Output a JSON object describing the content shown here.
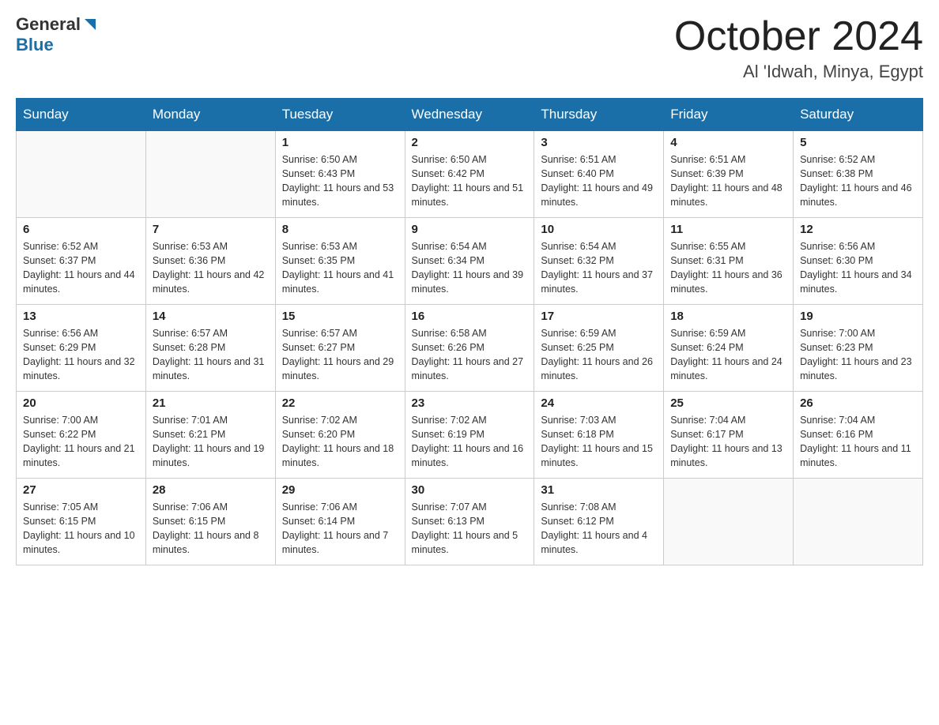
{
  "header": {
    "logo_general": "General",
    "logo_blue": "Blue",
    "month_title": "October 2024",
    "location": "Al 'Idwah, Minya, Egypt"
  },
  "days_of_week": [
    "Sunday",
    "Monday",
    "Tuesday",
    "Wednesday",
    "Thursday",
    "Friday",
    "Saturday"
  ],
  "weeks": [
    [
      {
        "day": "",
        "sunrise": "",
        "sunset": "",
        "daylight": ""
      },
      {
        "day": "",
        "sunrise": "",
        "sunset": "",
        "daylight": ""
      },
      {
        "day": "1",
        "sunrise": "Sunrise: 6:50 AM",
        "sunset": "Sunset: 6:43 PM",
        "daylight": "Daylight: 11 hours and 53 minutes."
      },
      {
        "day": "2",
        "sunrise": "Sunrise: 6:50 AM",
        "sunset": "Sunset: 6:42 PM",
        "daylight": "Daylight: 11 hours and 51 minutes."
      },
      {
        "day": "3",
        "sunrise": "Sunrise: 6:51 AM",
        "sunset": "Sunset: 6:40 PM",
        "daylight": "Daylight: 11 hours and 49 minutes."
      },
      {
        "day": "4",
        "sunrise": "Sunrise: 6:51 AM",
        "sunset": "Sunset: 6:39 PM",
        "daylight": "Daylight: 11 hours and 48 minutes."
      },
      {
        "day": "5",
        "sunrise": "Sunrise: 6:52 AM",
        "sunset": "Sunset: 6:38 PM",
        "daylight": "Daylight: 11 hours and 46 minutes."
      }
    ],
    [
      {
        "day": "6",
        "sunrise": "Sunrise: 6:52 AM",
        "sunset": "Sunset: 6:37 PM",
        "daylight": "Daylight: 11 hours and 44 minutes."
      },
      {
        "day": "7",
        "sunrise": "Sunrise: 6:53 AM",
        "sunset": "Sunset: 6:36 PM",
        "daylight": "Daylight: 11 hours and 42 minutes."
      },
      {
        "day": "8",
        "sunrise": "Sunrise: 6:53 AM",
        "sunset": "Sunset: 6:35 PM",
        "daylight": "Daylight: 11 hours and 41 minutes."
      },
      {
        "day": "9",
        "sunrise": "Sunrise: 6:54 AM",
        "sunset": "Sunset: 6:34 PM",
        "daylight": "Daylight: 11 hours and 39 minutes."
      },
      {
        "day": "10",
        "sunrise": "Sunrise: 6:54 AM",
        "sunset": "Sunset: 6:32 PM",
        "daylight": "Daylight: 11 hours and 37 minutes."
      },
      {
        "day": "11",
        "sunrise": "Sunrise: 6:55 AM",
        "sunset": "Sunset: 6:31 PM",
        "daylight": "Daylight: 11 hours and 36 minutes."
      },
      {
        "day": "12",
        "sunrise": "Sunrise: 6:56 AM",
        "sunset": "Sunset: 6:30 PM",
        "daylight": "Daylight: 11 hours and 34 minutes."
      }
    ],
    [
      {
        "day": "13",
        "sunrise": "Sunrise: 6:56 AM",
        "sunset": "Sunset: 6:29 PM",
        "daylight": "Daylight: 11 hours and 32 minutes."
      },
      {
        "day": "14",
        "sunrise": "Sunrise: 6:57 AM",
        "sunset": "Sunset: 6:28 PM",
        "daylight": "Daylight: 11 hours and 31 minutes."
      },
      {
        "day": "15",
        "sunrise": "Sunrise: 6:57 AM",
        "sunset": "Sunset: 6:27 PM",
        "daylight": "Daylight: 11 hours and 29 minutes."
      },
      {
        "day": "16",
        "sunrise": "Sunrise: 6:58 AM",
        "sunset": "Sunset: 6:26 PM",
        "daylight": "Daylight: 11 hours and 27 minutes."
      },
      {
        "day": "17",
        "sunrise": "Sunrise: 6:59 AM",
        "sunset": "Sunset: 6:25 PM",
        "daylight": "Daylight: 11 hours and 26 minutes."
      },
      {
        "day": "18",
        "sunrise": "Sunrise: 6:59 AM",
        "sunset": "Sunset: 6:24 PM",
        "daylight": "Daylight: 11 hours and 24 minutes."
      },
      {
        "day": "19",
        "sunrise": "Sunrise: 7:00 AM",
        "sunset": "Sunset: 6:23 PM",
        "daylight": "Daylight: 11 hours and 23 minutes."
      }
    ],
    [
      {
        "day": "20",
        "sunrise": "Sunrise: 7:00 AM",
        "sunset": "Sunset: 6:22 PM",
        "daylight": "Daylight: 11 hours and 21 minutes."
      },
      {
        "day": "21",
        "sunrise": "Sunrise: 7:01 AM",
        "sunset": "Sunset: 6:21 PM",
        "daylight": "Daylight: 11 hours and 19 minutes."
      },
      {
        "day": "22",
        "sunrise": "Sunrise: 7:02 AM",
        "sunset": "Sunset: 6:20 PM",
        "daylight": "Daylight: 11 hours and 18 minutes."
      },
      {
        "day": "23",
        "sunrise": "Sunrise: 7:02 AM",
        "sunset": "Sunset: 6:19 PM",
        "daylight": "Daylight: 11 hours and 16 minutes."
      },
      {
        "day": "24",
        "sunrise": "Sunrise: 7:03 AM",
        "sunset": "Sunset: 6:18 PM",
        "daylight": "Daylight: 11 hours and 15 minutes."
      },
      {
        "day": "25",
        "sunrise": "Sunrise: 7:04 AM",
        "sunset": "Sunset: 6:17 PM",
        "daylight": "Daylight: 11 hours and 13 minutes."
      },
      {
        "day": "26",
        "sunrise": "Sunrise: 7:04 AM",
        "sunset": "Sunset: 6:16 PM",
        "daylight": "Daylight: 11 hours and 11 minutes."
      }
    ],
    [
      {
        "day": "27",
        "sunrise": "Sunrise: 7:05 AM",
        "sunset": "Sunset: 6:15 PM",
        "daylight": "Daylight: 11 hours and 10 minutes."
      },
      {
        "day": "28",
        "sunrise": "Sunrise: 7:06 AM",
        "sunset": "Sunset: 6:15 PM",
        "daylight": "Daylight: 11 hours and 8 minutes."
      },
      {
        "day": "29",
        "sunrise": "Sunrise: 7:06 AM",
        "sunset": "Sunset: 6:14 PM",
        "daylight": "Daylight: 11 hours and 7 minutes."
      },
      {
        "day": "30",
        "sunrise": "Sunrise: 7:07 AM",
        "sunset": "Sunset: 6:13 PM",
        "daylight": "Daylight: 11 hours and 5 minutes."
      },
      {
        "day": "31",
        "sunrise": "Sunrise: 7:08 AM",
        "sunset": "Sunset: 6:12 PM",
        "daylight": "Daylight: 11 hours and 4 minutes."
      },
      {
        "day": "",
        "sunrise": "",
        "sunset": "",
        "daylight": ""
      },
      {
        "day": "",
        "sunrise": "",
        "sunset": "",
        "daylight": ""
      }
    ]
  ]
}
